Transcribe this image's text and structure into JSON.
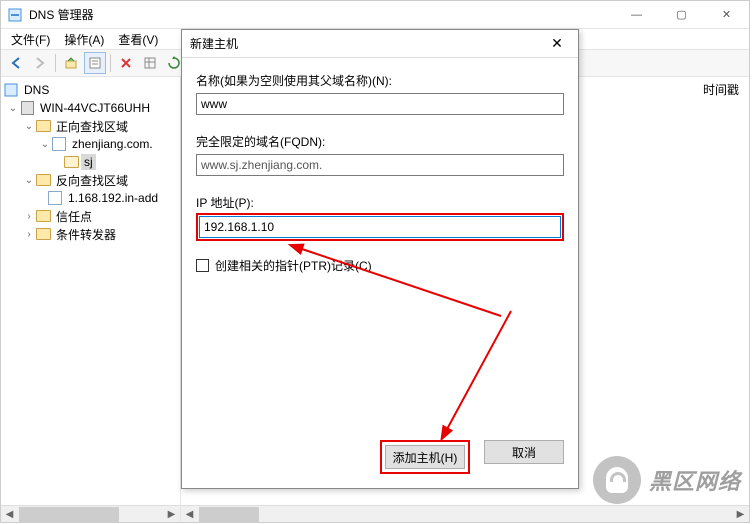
{
  "window": {
    "title": "DNS 管理器",
    "controls": {
      "min": "—",
      "max": "▢",
      "close": "✕"
    }
  },
  "menu": {
    "file": "文件(F)",
    "action": "操作(A)",
    "view": "查看(V)"
  },
  "toolbar_icons": {
    "back": "←",
    "forward": "→",
    "up": "⇧",
    "props": "▦",
    "delete": "✖",
    "refresh": "⟳",
    "help": "?"
  },
  "tree": {
    "root": "DNS",
    "server": "WIN-44VCJT66UHH",
    "fwd_zone": "正向查找区域",
    "zone1": "zhenjiang.com.",
    "sj": "sj",
    "rev_zone": "反向查找区域",
    "revzone1": "1.168.192.in-add",
    "trust": "信任点",
    "cond_fwd": "条件转发器"
  },
  "right": {
    "col_timestamp": "时间戳"
  },
  "dialog": {
    "title": "新建主机",
    "close": "✕",
    "name_label": "名称(如果为空则使用其父域名称)(N):",
    "name_value": "www",
    "fqdn_label": "完全限定的域名(FQDN):",
    "fqdn_value": "www.sj.zhenjiang.com.",
    "ip_label": "IP 地址(P):",
    "ip_value": "192.168.1.10",
    "ptr_label": "创建相关的指针(PTR)记录(C)",
    "add_btn": "添加主机(H)",
    "cancel_btn": "取消"
  },
  "watermark": "黑区网络"
}
